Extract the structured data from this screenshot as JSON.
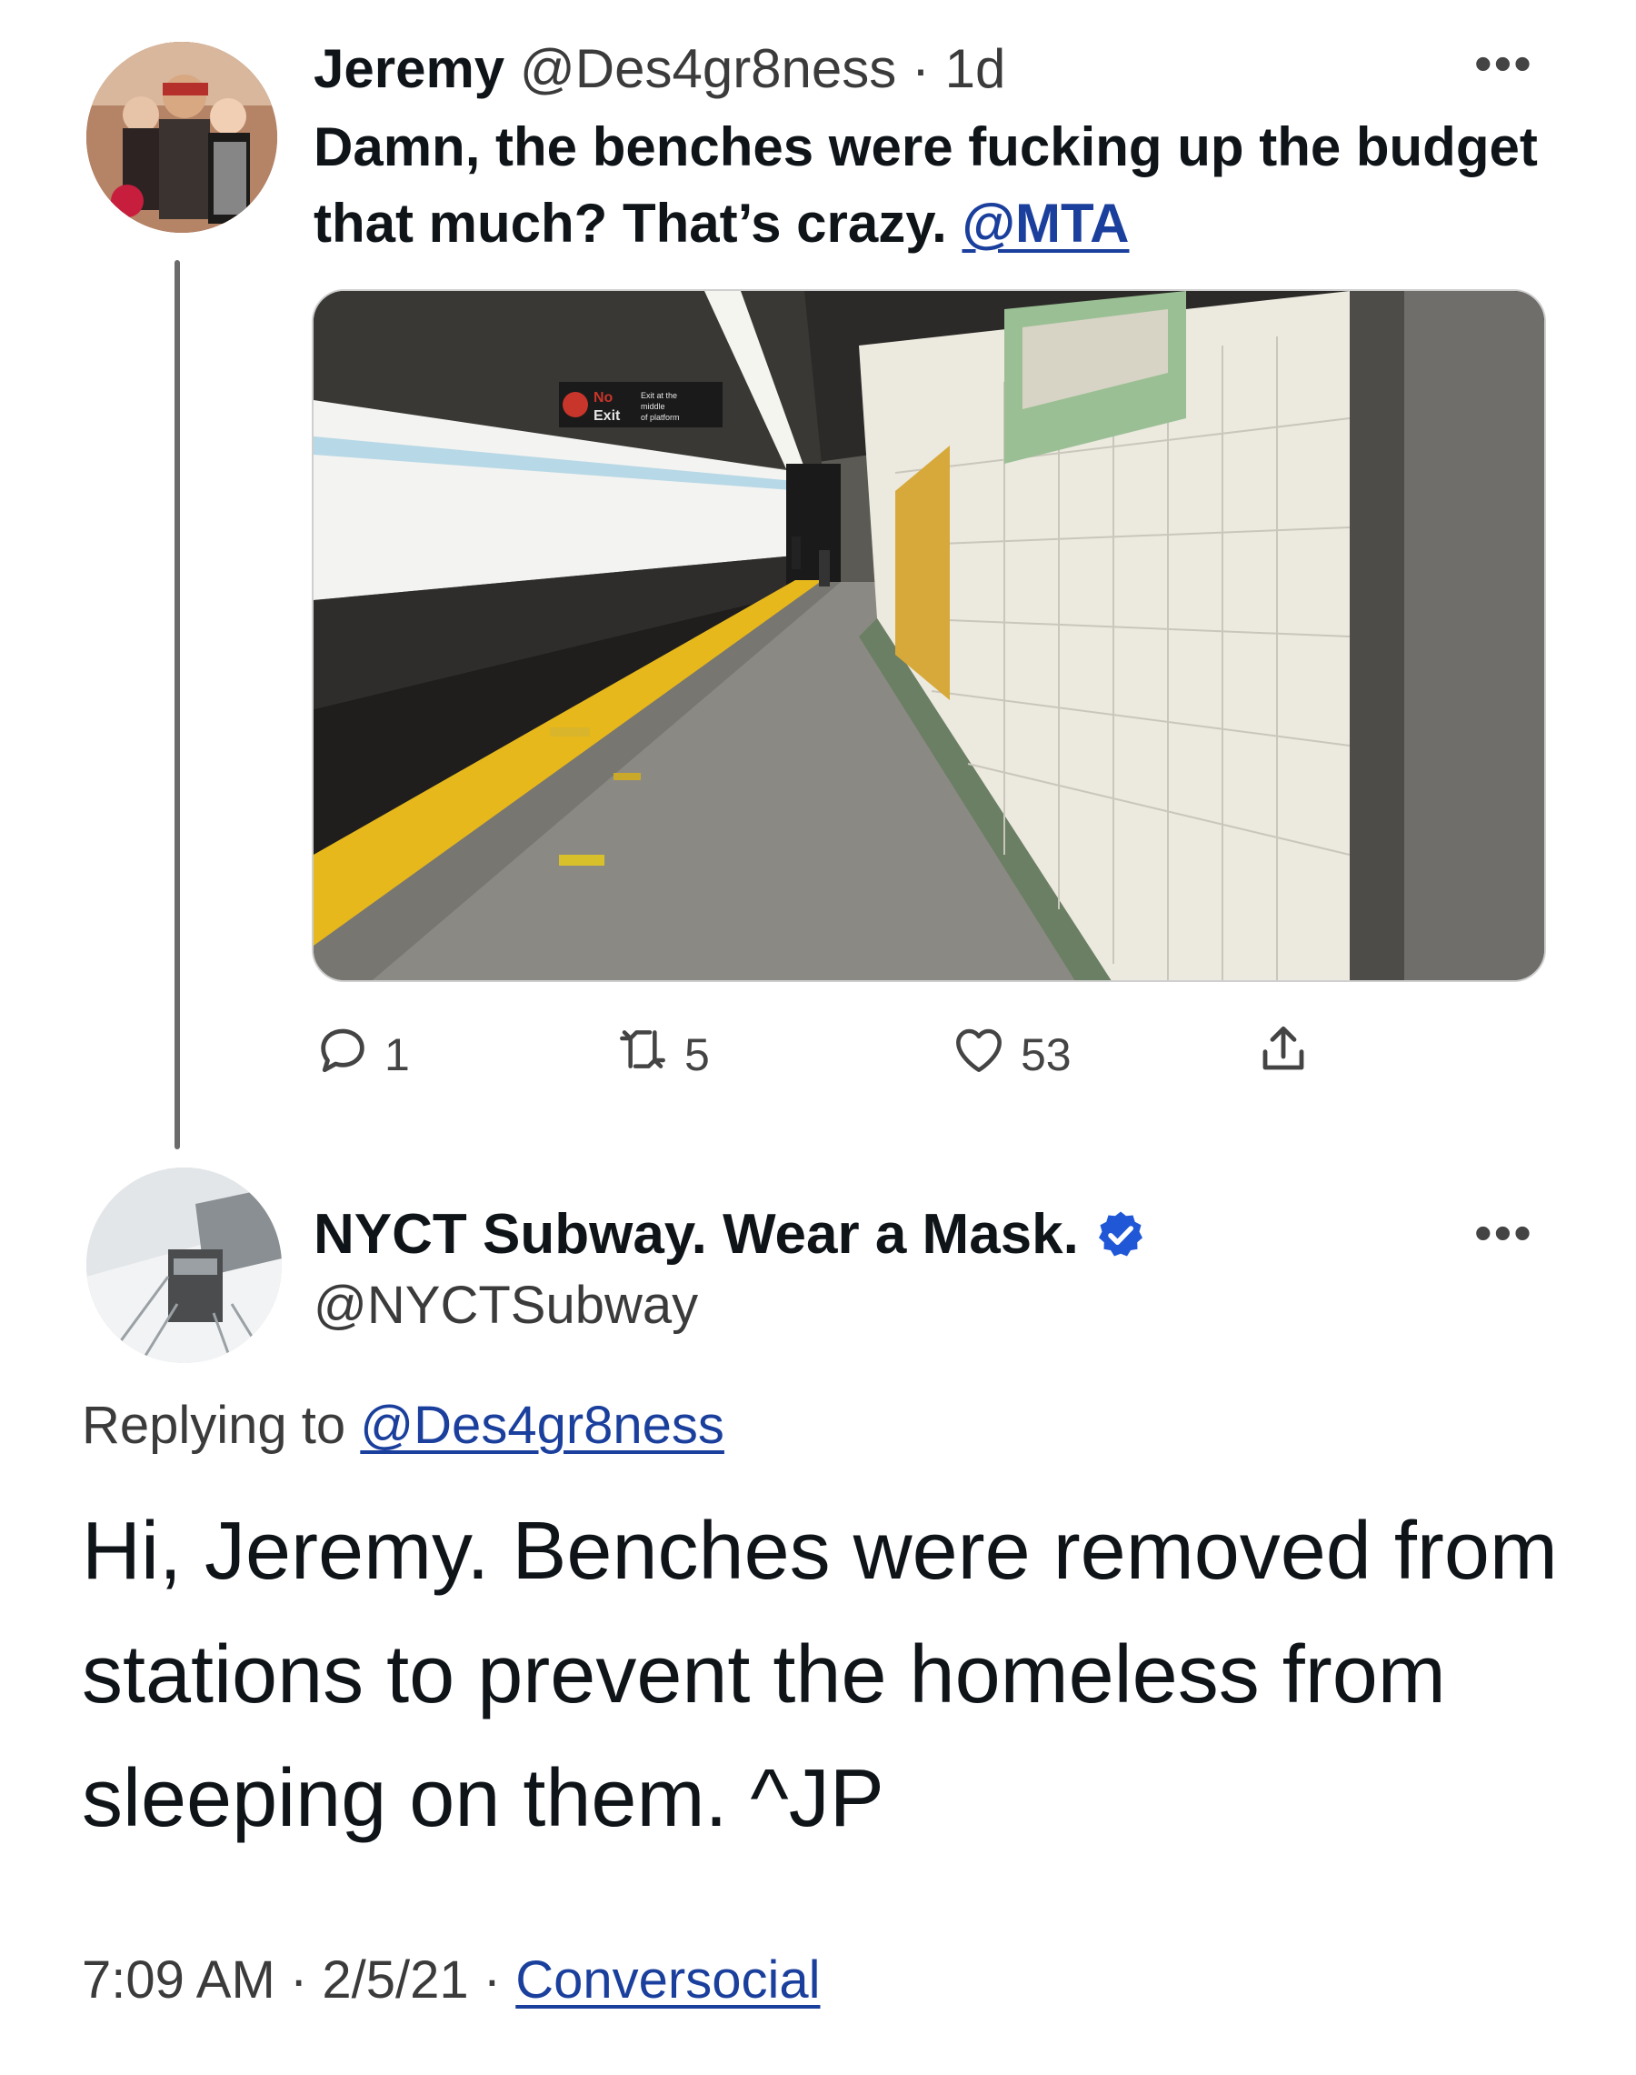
{
  "tweet": {
    "author_name": "Jeremy",
    "handle": "@Des4gr8ness",
    "separator": "·",
    "time_ago": "1d",
    "more_icon": "ellipsis-icon",
    "text": "Damn, the benches were fucking up the budget that much? That’s crazy. ",
    "mention": "@MTA",
    "image_description": "subway-platform-photo",
    "sign_text": {
      "no": "No",
      "exit": "Exit",
      "detail_1": "Exit at the",
      "detail_2": "middle",
      "detail_3": "of platform"
    },
    "actions": {
      "reply_count": "1",
      "retweet_count": "5",
      "like_count": "53"
    }
  },
  "reply": {
    "author_name": "NYCT Subway. Wear a Mask.",
    "handle": "@NYCTSubway",
    "verified_icon": "verified-badge-icon",
    "more_icon": "ellipsis-icon",
    "replying_prefix": "Replying to ",
    "replying_to": "@Des4gr8ness",
    "text": "Hi, Jeremy. Benches were removed from stations to prevent the homeless from sleeping on them. ^JP",
    "time": "7:09 AM",
    "date": "2/5/21",
    "separator": "·",
    "source": "Conversocial"
  },
  "colors": {
    "link": "#1a3f9c",
    "verified": "#1d9bf0",
    "text": "#0f1419",
    "muted": "#3b3b3b"
  }
}
